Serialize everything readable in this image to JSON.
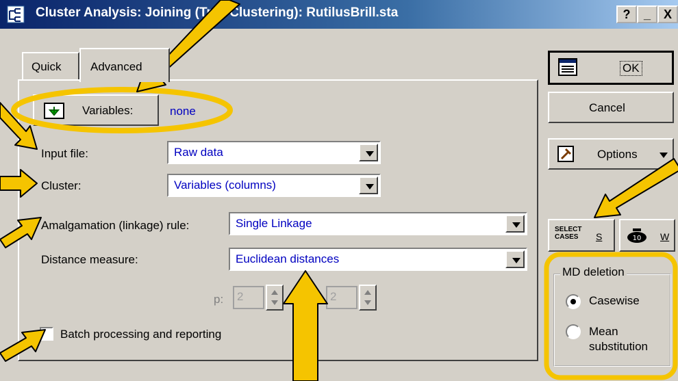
{
  "window": {
    "title": "Cluster Analysis: Joining (Tree Clustering): RutilusBrill.sta",
    "help_button": "?",
    "minimize_button": "_",
    "close_button": "X"
  },
  "tabs": [
    {
      "label": "Quick",
      "active": false
    },
    {
      "label": "Advanced",
      "active": true
    }
  ],
  "variables": {
    "button_label": "Variables:",
    "value": "none"
  },
  "fields": {
    "input_file": {
      "label": "Input file:",
      "value": "Raw data"
    },
    "cluster": {
      "label": "Cluster:",
      "value": "Variables (columns)"
    },
    "linkage_rule": {
      "label": "Amalgamation (linkage) rule:",
      "value": "Single Linkage"
    },
    "distance_measure": {
      "label": "Distance measure:",
      "value": "Euclidean distances"
    }
  },
  "power_params": {
    "p_label": "p:",
    "p_value": "2",
    "r_value": "2",
    "enabled": false
  },
  "batch": {
    "label": "Batch processing and reporting",
    "checked": false
  },
  "buttons": {
    "ok": "OK",
    "cancel": "Cancel",
    "options": "Options",
    "select_cases": "SELECT\nCASES",
    "select_cases_key": "S",
    "weight_key": "W"
  },
  "md_deletion": {
    "title": "MD deletion",
    "options": [
      {
        "label": "Casewise",
        "selected": true
      },
      {
        "label": "Mean substitution",
        "selected": false
      }
    ]
  },
  "highlight_color": "#f5c400"
}
